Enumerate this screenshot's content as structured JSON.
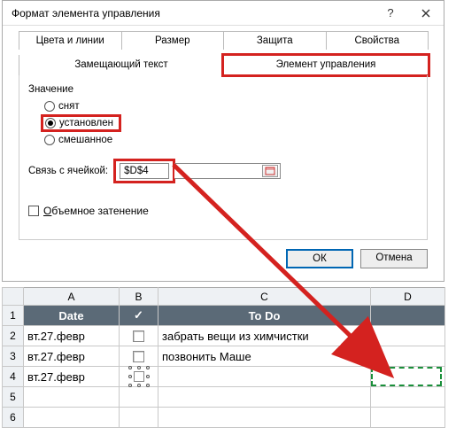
{
  "dialog": {
    "title": "Формат элемента управления",
    "tabs_row1": [
      "Цвета и линии",
      "Размер",
      "Защита",
      "Свойства"
    ],
    "tabs_row2": [
      "Замещающий текст",
      "Элемент управления"
    ],
    "value_label": "Значение",
    "radios": [
      "снят",
      "установлен",
      "смешанное"
    ],
    "cell_link_label": "Связь с ячейкой:",
    "cell_link_value": "$D$4",
    "shadow_label": "Объемное затенение",
    "ok": "ОК",
    "cancel": "Отмена"
  },
  "sheet": {
    "cols": [
      "A",
      "B",
      "C",
      "D"
    ],
    "header": {
      "date": "Date",
      "check": "✓",
      "todo": "To Do"
    },
    "rows": [
      {
        "n": "2",
        "date": "вт.27.февр",
        "chk": "unchecked",
        "todo": "забрать вещи из химчистки"
      },
      {
        "n": "3",
        "date": "вт.27.февр",
        "chk": "unchecked",
        "todo": "позвонить Маше"
      },
      {
        "n": "4",
        "date": "вт.27.февр",
        "chk": "edit",
        "todo": ""
      },
      {
        "n": "5",
        "date": "",
        "chk": "",
        "todo": ""
      },
      {
        "n": "6",
        "date": "",
        "chk": "",
        "todo": ""
      }
    ]
  }
}
